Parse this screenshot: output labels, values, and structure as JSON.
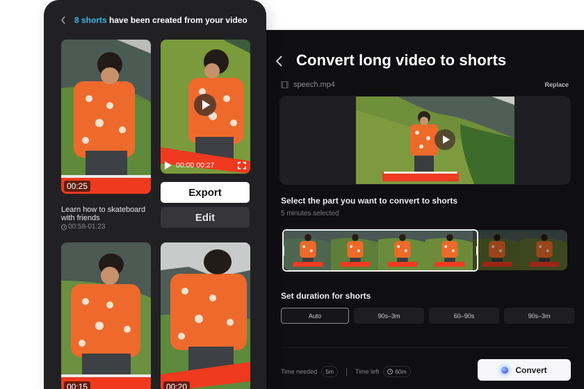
{
  "left_panel": {
    "header": {
      "back_icon": "chevron-left-icon",
      "count_highlight": "8 shorts",
      "title_rest": " have been created from your video",
      "highlight_color": "#3fb4e8"
    },
    "shorts": [
      {
        "timestamp": "00:25",
        "title": "Learn how to skateboard with friends",
        "range": "00:58-01:23"
      },
      {
        "current_time": "00:00",
        "duration": "00:27",
        "state": "paused"
      },
      {
        "timestamp": "00:15"
      },
      {
        "timestamp": "00:20"
      }
    ],
    "actions": {
      "export_label": "Export",
      "edit_label": "Edit"
    }
  },
  "right_panel": {
    "title": "Convert long video to shorts",
    "back_icon": "chevron-left-icon",
    "file": {
      "icon": "film-icon",
      "name": "speech.mp4",
      "replace_label": "Replace"
    },
    "select_section": {
      "title": "Select the part you want to convert to shorts",
      "subtitle": "5 minutes selected",
      "frame_count": 6,
      "selected_frames": 4
    },
    "duration_section": {
      "title": "Set duration for shorts",
      "options": [
        "Auto",
        "90s–3m",
        "60–90s",
        "90s–3m"
      ],
      "selected": "Auto"
    },
    "footer": {
      "time_needed_label": "Time needed",
      "time_needed_value": "5m",
      "time_left_label": "Time left",
      "time_left_value": "60m",
      "convert_label": "Convert"
    }
  }
}
